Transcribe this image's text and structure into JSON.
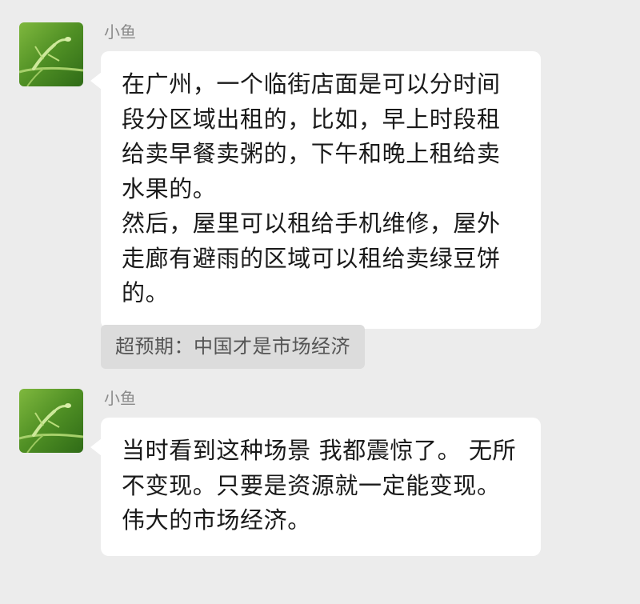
{
  "colors": {
    "background": "#ececec",
    "bubble": "#ffffff",
    "quote_bg": "#dcdcdc",
    "sender_name": "#8a8a8a",
    "avatar_green": "#5c9a2e"
  },
  "messages": [
    {
      "sender": "小鱼",
      "avatar_icon": "praying-mantis-avatar",
      "paragraphs": [
        "在广州，一个临街店面是可以分时间段分区域出租的，比如，早上时段租给卖早餐卖粥的，下午和晚上租给卖水果的。",
        "然后，屋里可以租给手机维修，屋外走廊有避雨的区域可以租给卖绿豆饼的。"
      ],
      "quote": "超预期：中国才是市场经济"
    },
    {
      "sender": "小鱼",
      "avatar_icon": "praying-mantis-avatar",
      "paragraphs": [
        "当时看到这种场景 我都震惊了。 无所不变现。只要是资源就一定能变现。",
        "伟大的市场经济。"
      ]
    }
  ]
}
